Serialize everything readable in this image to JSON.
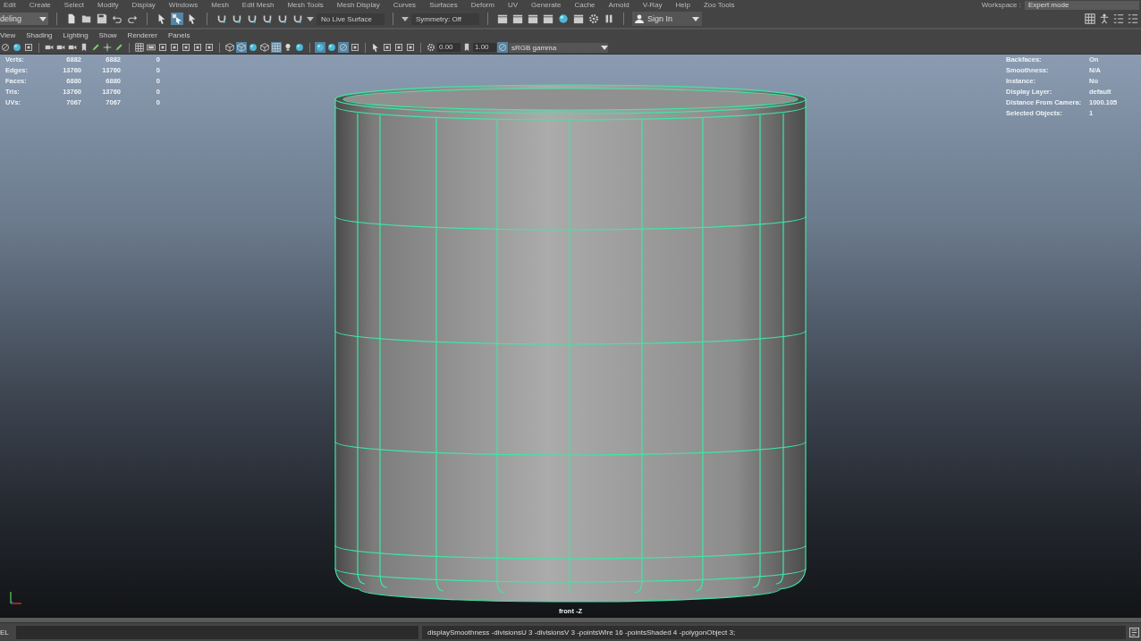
{
  "menu_bar": [
    "Edit",
    "Create",
    "Select",
    "Modify",
    "Display",
    "Windows",
    "Mesh",
    "Edit Mesh",
    "Mesh Tools",
    "Mesh Display",
    "Curves",
    "Surfaces",
    "Deform",
    "UV",
    "Generate",
    "Cache",
    "Arnold",
    "V-Ray",
    "Help",
    "Zoo Tools"
  ],
  "workspace": {
    "label": "Workspace :",
    "value": "Expert mode"
  },
  "toolbar": {
    "mode": "deling",
    "groups": [
      [
        {
          "kind": "page",
          "selected": false
        },
        {
          "kind": "folder",
          "selected": false
        },
        {
          "kind": "disk",
          "selected": false
        },
        {
          "kind": "undo",
          "selected": false
        },
        {
          "kind": "redo",
          "selected": false
        }
      ],
      [
        {
          "kind": "arrow",
          "selected": false
        },
        {
          "kind": "lasso",
          "selected": true
        },
        {
          "kind": "arrow",
          "selected": false
        }
      ],
      [
        {
          "kind": "magnet",
          "selected": false
        },
        {
          "kind": "magnet",
          "selected": false
        },
        {
          "kind": "magnet",
          "selected": false
        },
        {
          "kind": "magnet",
          "selected": false
        },
        {
          "kind": "magnet",
          "selected": false
        },
        {
          "kind": "magnet",
          "selected": false
        }
      ],
      [
        {
          "kind": "clapper",
          "selected": false
        },
        {
          "kind": "clapper",
          "selected": false
        },
        {
          "kind": "clapper",
          "selected": false
        },
        {
          "kind": "clapper",
          "selected": false
        },
        {
          "kind": "sphere",
          "selected": false
        },
        {
          "kind": "clapper",
          "selected": false
        },
        {
          "kind": "gear",
          "selected": false
        },
        {
          "kind": "pause",
          "selected": false
        }
      ],
      [
        {
          "kind": "grid",
          "selected": false
        },
        {
          "kind": "figure",
          "selected": false
        },
        {
          "kind": "list",
          "selected": false
        },
        {
          "kind": "list",
          "selected": false
        }
      ]
    ],
    "live_surface": "No Live Surface",
    "symmetry": "Symmetry: Off",
    "sign_in": "Sign In"
  },
  "panel_menu": [
    "View",
    "Shading",
    "Lighting",
    "Show",
    "Renderer",
    "Panels"
  ],
  "panel_toolbar": {
    "groups": [
      [
        {
          "kind": "circle",
          "selected": false
        },
        {
          "kind": "sphere",
          "selected": false
        },
        {
          "kind": "square",
          "selected": false
        }
      ],
      [
        {
          "kind": "camera",
          "selected": false
        },
        {
          "kind": "camera",
          "selected": false
        },
        {
          "kind": "camera",
          "selected": false
        },
        {
          "kind": "bookmark",
          "selected": false
        },
        {
          "kind": "pen",
          "selected": false
        },
        {
          "kind": "move",
          "selected": false
        },
        {
          "kind": "pen",
          "selected": false
        }
      ],
      [
        {
          "kind": "grid",
          "selected": false
        },
        {
          "kind": "film",
          "selected": false
        },
        {
          "kind": "square",
          "selected": false
        },
        {
          "kind": "square",
          "selected": false
        },
        {
          "kind": "square",
          "selected": false
        },
        {
          "kind": "square",
          "selected": false
        },
        {
          "kind": "square",
          "selected": false
        }
      ],
      [
        {
          "kind": "cube",
          "selected": false
        },
        {
          "kind": "cube",
          "selected": true
        },
        {
          "kind": "sphere",
          "selected": false
        },
        {
          "kind": "cube",
          "selected": false
        },
        {
          "kind": "grid",
          "selected": true
        },
        {
          "kind": "bulb",
          "selected": false
        },
        {
          "kind": "sphere",
          "selected": false
        }
      ],
      [
        {
          "kind": "sphere",
          "selected": true
        },
        {
          "kind": "sphere",
          "selected": false
        },
        {
          "kind": "circle",
          "selected": true
        },
        {
          "kind": "square",
          "selected": false
        }
      ],
      [
        {
          "kind": "arrow",
          "selected": false
        },
        {
          "kind": "square",
          "selected": false
        },
        {
          "kind": "square",
          "selected": false
        },
        {
          "kind": "square",
          "selected": false
        }
      ]
    ],
    "exposure": "0.00",
    "gamma": "1.00",
    "color_space": "sRGB gamma"
  },
  "viewport": {
    "stats": [
      {
        "label": "Verts:",
        "values": [
          "6882",
          "6882",
          "0"
        ]
      },
      {
        "label": "Edges:",
        "values": [
          "13760",
          "13760",
          "0"
        ]
      },
      {
        "label": "Faces:",
        "values": [
          "6880",
          "6880",
          "0"
        ]
      },
      {
        "label": "Tris:",
        "values": [
          "13760",
          "13760",
          "0"
        ]
      },
      {
        "label": "UVs:",
        "values": [
          "7067",
          "7067",
          "0"
        ]
      }
    ],
    "info": [
      {
        "label": "Backfaces:",
        "value": "On"
      },
      {
        "label": "Smoothness:",
        "value": "N/A"
      },
      {
        "label": "Instance:",
        "value": "No"
      },
      {
        "label": "Display Layer:",
        "value": "default"
      },
      {
        "label": "Distance From Camera:",
        "value": "1000.105"
      },
      {
        "label": "Selected Objects:",
        "value": "1"
      }
    ],
    "camera": "front -Z"
  },
  "command_line": {
    "language": "EL",
    "result": "displaySmoothness -divisionsU 3 -divisionsV 3 -pointsWire 16 -pointsShaded 4 -polygonObject 3;"
  }
}
